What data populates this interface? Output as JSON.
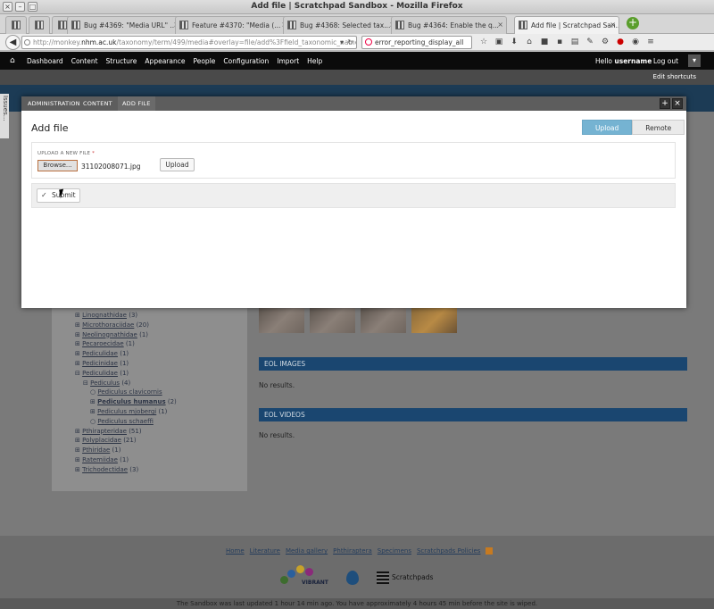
{
  "window": {
    "title": "Add file | Scratchpad Sandbox - Mozilla Firefox"
  },
  "tabs": [
    {
      "label": "Bug #4369: \"Media URL\" ...",
      "active": false
    },
    {
      "label": "Feature #4370: \"Media (...",
      "active": false
    },
    {
      "label": "Bug #4368: Selected tax...",
      "active": false
    },
    {
      "label": "Bug #4364: Enable the q...",
      "active": false
    },
    {
      "label": "Add file | Scratchpad San...",
      "active": true
    }
  ],
  "navbar": {
    "url_prefix": "http://monkey.",
    "url_domain": "nhm.ac.uk",
    "url_rest": "/taxonomy/term/499/media#overlay=file/add%3Ffield_taxonomic_name%3D499",
    "search": "error_reporting_display_all"
  },
  "toolbar": {
    "items": [
      "Dashboard",
      "Content",
      "Structure",
      "Appearance",
      "People",
      "Configuration",
      "Import",
      "Help"
    ],
    "hello_prefix": "Hello ",
    "username": "username",
    "logout": "Log out",
    "edit_shortcuts": "Edit shortcuts"
  },
  "issues_tab": "Issues...",
  "modal": {
    "tabs": [
      "ADMINISTRATION",
      "CONTENT",
      "ADD FILE"
    ],
    "title": "Add file",
    "upload_seg": "Upload",
    "remote_seg": "Remote",
    "upload_label": "UPLOAD A NEW FILE",
    "required_mark": "*",
    "browse": "Browse...",
    "filename": "31102008071.jpg",
    "upload_button": "Upload",
    "submit": "Submit"
  },
  "tree": [
    {
      "label": "Linognathidae",
      "count": "(3)",
      "level": 1
    },
    {
      "label": "Microthoraciidae",
      "count": "(20)",
      "level": 1
    },
    {
      "label": "Neolinognathidae",
      "count": "(1)",
      "level": 1
    },
    {
      "label": "Pecaroecidae",
      "count": "(1)",
      "level": 1
    },
    {
      "label": "Pediculidae",
      "count": "(1)",
      "level": 1
    },
    {
      "label": "Pedicinidae",
      "count": "(1)",
      "level": 1
    },
    {
      "label": "Pediculidae",
      "count": "(1)",
      "level": 1
    },
    {
      "label": "Pediculus",
      "count": "(4)",
      "level": 2
    },
    {
      "label": "Pediculus clavicornis",
      "count": "",
      "level": 3
    },
    {
      "label": "Pediculus humanus",
      "count": "(2)",
      "level": 3,
      "bold": true
    },
    {
      "label": "Pediculus mjobergi",
      "count": "(1)",
      "level": 3
    },
    {
      "label": "Pediculus schaeffi",
      "count": "",
      "level": 3
    },
    {
      "label": "Pthirapteridae",
      "count": "(51)",
      "level": 1
    },
    {
      "label": "Polyplacidae",
      "count": "(21)",
      "level": 1
    },
    {
      "label": "Pthiridae",
      "count": "(1)",
      "level": 1
    },
    {
      "label": "Ratemiidae",
      "count": "(1)",
      "level": 1
    },
    {
      "label": "Trichodectidae",
      "count": "(3)",
      "level": 1
    }
  ],
  "eol": {
    "images_header": "EOL IMAGES",
    "images_result": "No results.",
    "videos_header": "EOL VIDEOS",
    "videos_result": "No results."
  },
  "footer": {
    "links": [
      "Home",
      "Literature",
      "Media gallery",
      "Phthiraptera",
      "Specimens",
      "Scratchpads Policies"
    ],
    "vibrant": "VIBRANT",
    "scratchpads": "Scratchpads",
    "sandbox_note": "The Sandbox was last updated 1 hour 14 min ago. You have approximately 4 hours 45 min before the site is wiped."
  }
}
